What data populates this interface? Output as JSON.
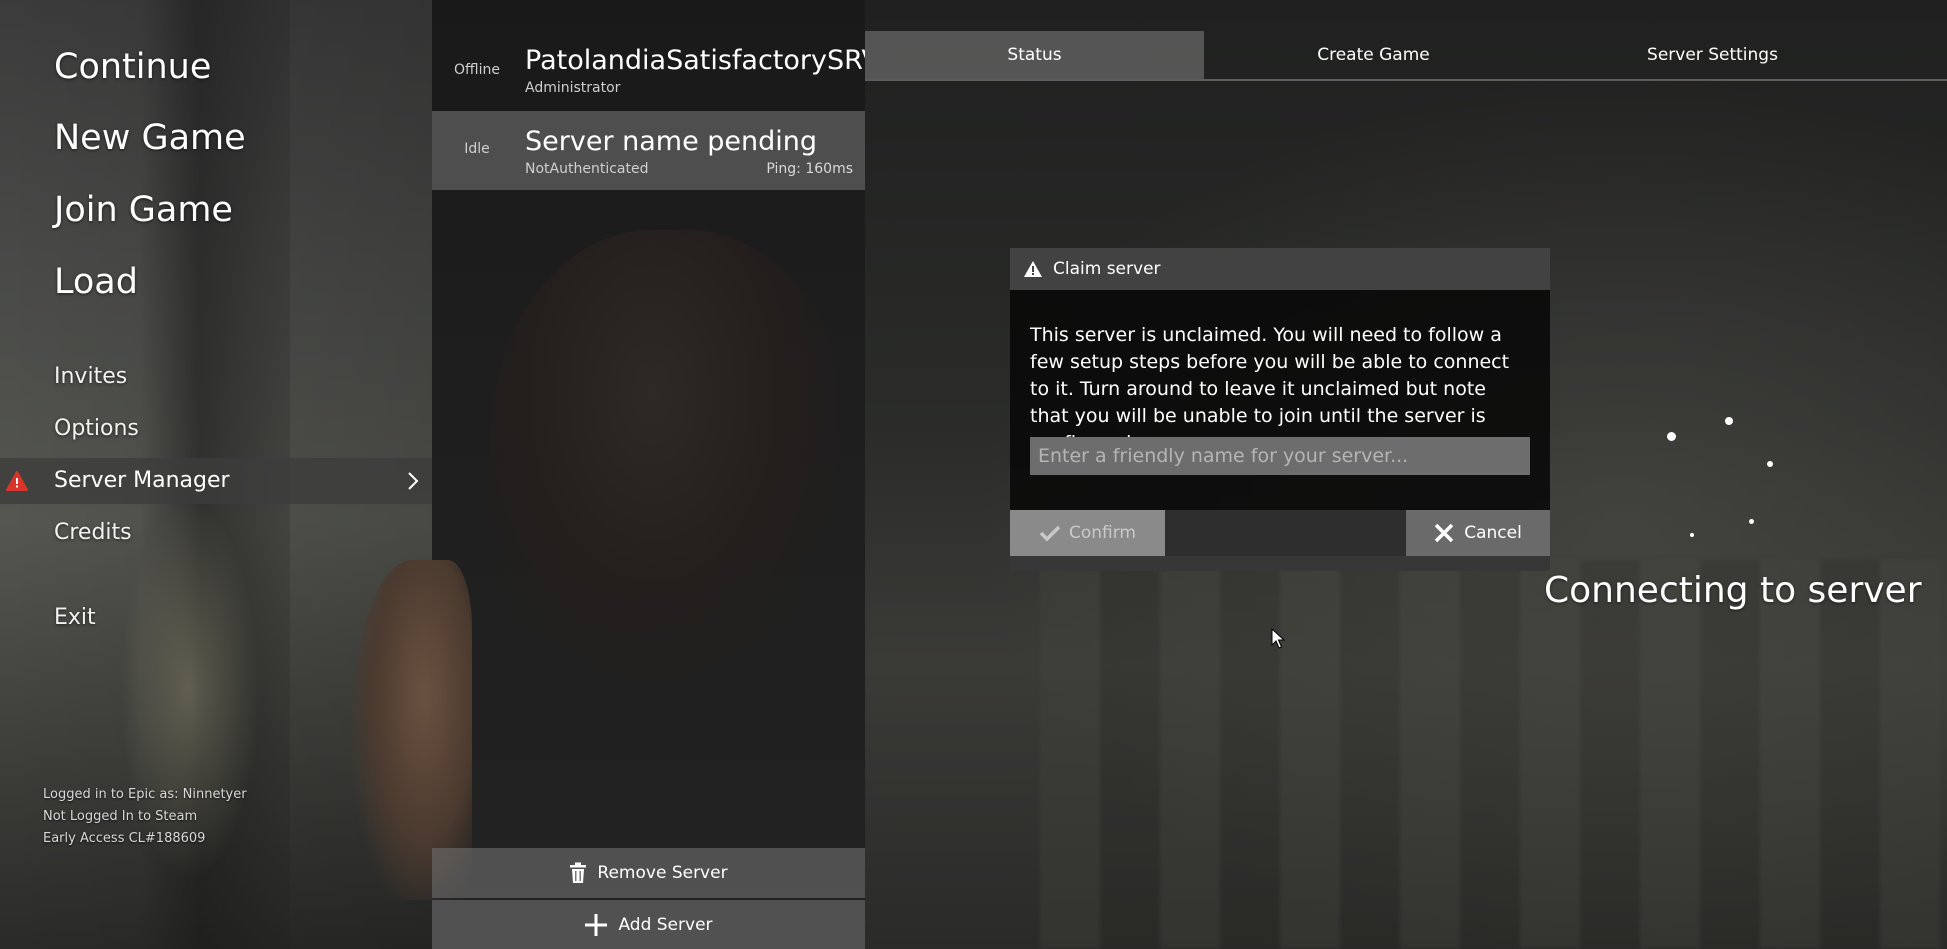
{
  "main_menu": {
    "items": [
      {
        "label": "Continue"
      },
      {
        "label": "New Game"
      },
      {
        "label": "Join Game"
      },
      {
        "label": "Load"
      },
      {
        "label": "Invites"
      },
      {
        "label": "Options"
      },
      {
        "label": "Server Manager"
      },
      {
        "label": "Credits"
      },
      {
        "label": "Exit"
      }
    ]
  },
  "login_info": {
    "epic": "Logged in to Epic as: Ninnetyer",
    "steam": "Not Logged In to Steam",
    "build": "Early Access CL#188609"
  },
  "servers": [
    {
      "state": "Offline",
      "name": "PatolandiaSatisfactorySRVR",
      "role": "Administrator",
      "ping": ""
    },
    {
      "state": "Idle",
      "name": "Server name pending",
      "role": "NotAuthenticated",
      "ping": "Ping: 160ms"
    }
  ],
  "server_list_actions": {
    "remove": "Remove Server",
    "add": "Add Server"
  },
  "tabs": [
    {
      "label": "Status",
      "active": true
    },
    {
      "label": "Create Game",
      "active": false
    },
    {
      "label": "Server Settings",
      "active": false
    }
  ],
  "status": {
    "connecting_text": "Connecting to server"
  },
  "dialog": {
    "title": "Claim server",
    "body": "This server is unclaimed. You will need to follow a few setup steps before you will be able to connect to it. Turn around to leave it unclaimed but note that you will be unable to join until the server is configured.",
    "input_placeholder": "Enter a friendly name for your server...",
    "input_value": "",
    "confirm_label": "Confirm",
    "cancel_label": "Cancel"
  },
  "colors": {
    "warning_red": "#d9342b",
    "panel_gray": "#6d6d6d",
    "highlight_gray": "#787878"
  },
  "icons": {
    "warning": "warning-icon",
    "chevron": "chevron-right-icon",
    "trash": "trash-icon",
    "plus": "plus-icon",
    "check": "check-icon",
    "close": "close-icon"
  }
}
